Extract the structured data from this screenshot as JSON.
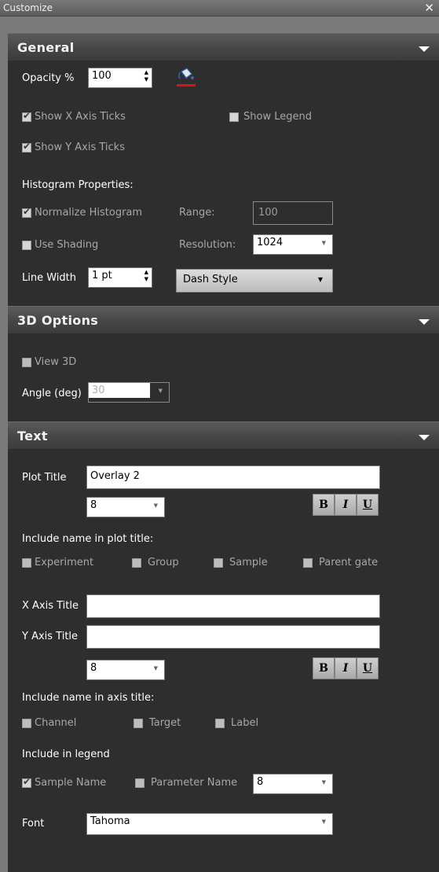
{
  "window": {
    "title": "Customize",
    "close_glyph": "✕"
  },
  "general": {
    "header": "General",
    "opacity_label": "Opacity %",
    "opacity_value": "100",
    "show_x_axis_ticks": "Show X Axis Ticks",
    "show_legend": "Show Legend",
    "show_y_axis_ticks": "Show Y Axis Ticks",
    "histogram_properties": "Histogram Properties:",
    "normalize_histogram": "Normalize Histogram",
    "range_label": "Range:",
    "range_value": "100",
    "use_shading": "Use Shading",
    "resolution_label": "Resolution:",
    "resolution_value": "1024",
    "line_width_label": "Line Width",
    "line_width_value": "1 pt",
    "dash_style": "Dash Style"
  },
  "options3d": {
    "header": "3D Options",
    "view3d": "View 3D",
    "angle_label": "Angle (deg)",
    "angle_value": "30"
  },
  "text": {
    "header": "Text",
    "plot_title_label": "Plot Title",
    "plot_title_value": "Overlay 2",
    "plot_title_size": "8",
    "bold": "B",
    "italic": "I",
    "underline": "U",
    "include_name_plot_title": "Include name in plot title:",
    "experiment": "Experiment",
    "group": "Group",
    "sample": "Sample",
    "parent_gate": "Parent gate",
    "x_axis_title_label": "X Axis Title",
    "x_axis_title_value": "",
    "y_axis_title_label": "Y Axis Title",
    "y_axis_title_value": "",
    "axis_title_size": "8",
    "include_name_axis_title": "Include name in axis title:",
    "channel": "Channel",
    "target": "Target",
    "label": "Label",
    "include_in_legend": "Include in legend",
    "sample_name": "Sample Name",
    "parameter_name": "Parameter Name",
    "legend_size": "8",
    "font_label": "Font",
    "font_value": "Tahoma"
  },
  "colors": {
    "fill_indicator": "#e01010",
    "panel": "#2e2e2e"
  },
  "icons": {
    "fill_color": "paint-bucket-icon",
    "collapse": "chevron-down-icon"
  }
}
